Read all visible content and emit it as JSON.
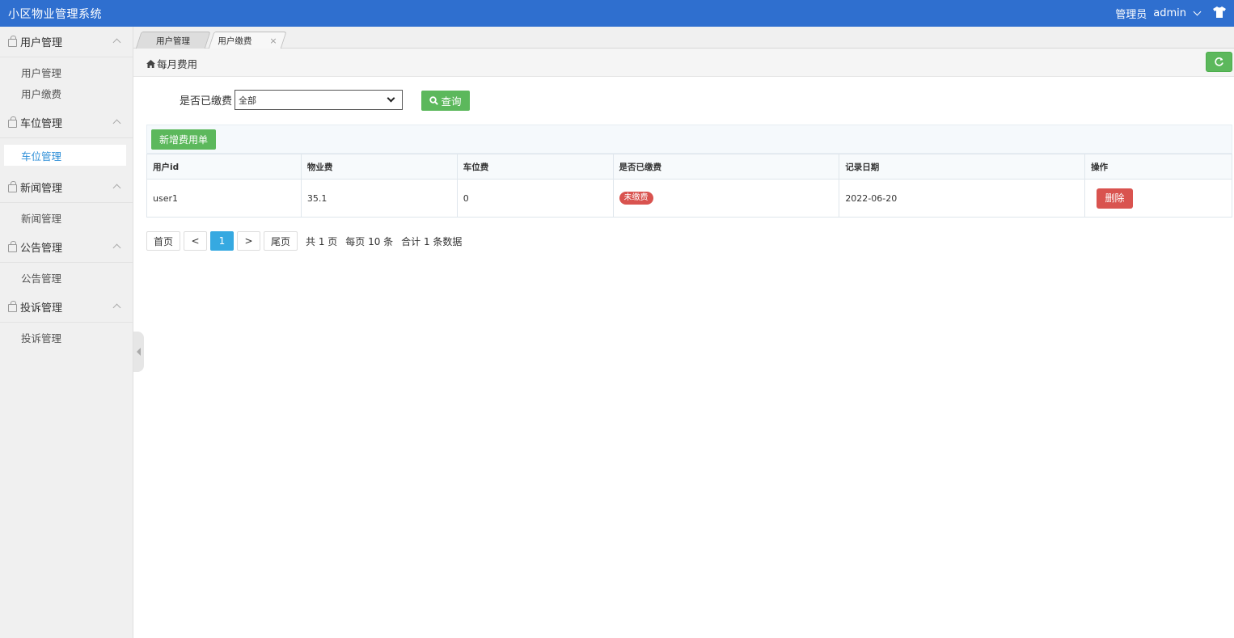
{
  "header": {
    "app_title": "小区物业管理系统",
    "role": "管理员",
    "username": "admin"
  },
  "sidebar": {
    "groups": [
      {
        "label": "用户管理",
        "items": [
          "用户管理",
          "用户缴费"
        ]
      },
      {
        "label": "车位管理",
        "items": [
          "车位管理"
        ]
      },
      {
        "label": "新闻管理",
        "items": [
          "新闻管理"
        ]
      },
      {
        "label": "公告管理",
        "items": [
          "公告管理"
        ]
      },
      {
        "label": "投诉管理",
        "items": [
          "投诉管理"
        ]
      }
    ],
    "active_item": "车位管理"
  },
  "tabs": [
    {
      "label": "用户管理",
      "active": false
    },
    {
      "label": "用户缴费",
      "active": true,
      "close": "×"
    }
  ],
  "breadcrumb": {
    "title": "每月费用"
  },
  "search": {
    "label": "是否已缴费",
    "selected": "全部",
    "query_label": "查询"
  },
  "toolbar": {
    "add_label": "新增费用单"
  },
  "table": {
    "columns": [
      "用户id",
      "物业费",
      "车位费",
      "是否已缴费",
      "记录日期",
      "操作"
    ],
    "rows": [
      {
        "user_id": "user1",
        "property_fee": "35.1",
        "parking_fee": "0",
        "paid_status": "未缴费",
        "date": "2022-06-20",
        "action": "删除"
      }
    ]
  },
  "pagination": {
    "first": "首页",
    "prev": "<",
    "current": "1",
    "next": ">",
    "last": "尾页",
    "total_pages": "共 1 页",
    "per_page": "每页 10 条",
    "total_records": "合计 1 条数据"
  },
  "colors": {
    "header_bg": "#2f6fcf",
    "success": "#5cb85c",
    "danger": "#d9534f",
    "active_link": "#2f8fd8",
    "pager_current": "#36a9e1"
  }
}
